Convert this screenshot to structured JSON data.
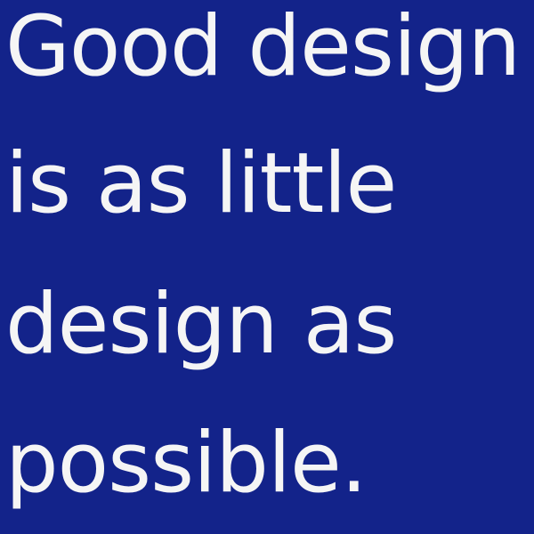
{
  "quote": {
    "lines": [
      "Good design",
      "is as little",
      "design as",
      "possible."
    ]
  },
  "colors": {
    "background": "#13238a",
    "text": "#f5f5f5"
  }
}
